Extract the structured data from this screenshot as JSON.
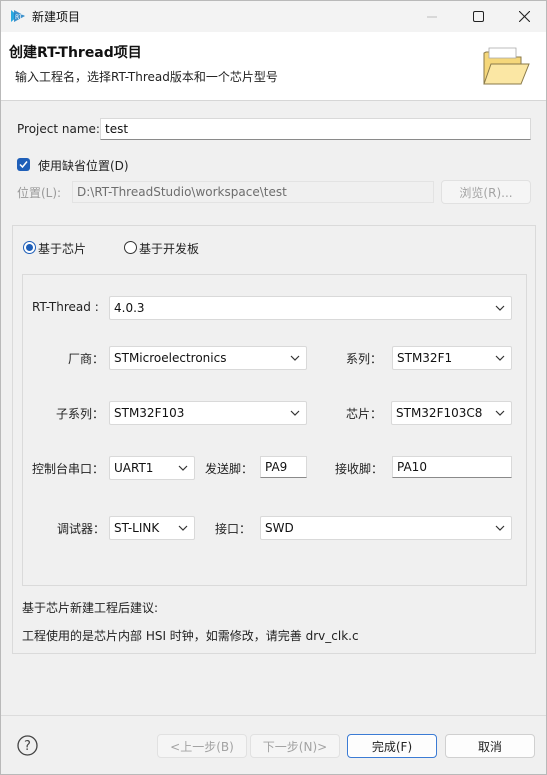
{
  "window": {
    "title": "新建项目"
  },
  "header": {
    "title": "创建RT-Thread项目",
    "description": "输入工程名，选择RT-Thread版本和一个芯片型号"
  },
  "project": {
    "name_label": "Project name:",
    "name_value": "test",
    "use_default_location_label": "使用缺省位置(D)",
    "use_default_location_checked": true,
    "location_label": "位置(L):",
    "location_value": "D:\\RT-ThreadStudio\\workspace\\test",
    "browse_label": "浏览(R)..."
  },
  "mode": {
    "chip_label": "基于芯片",
    "board_label": "基于开发板",
    "selected": "chip"
  },
  "config": {
    "rtthread_label": "RT-Thread :",
    "rtthread_value": "4.0.3",
    "vendor_label": "厂商：",
    "vendor_value": "STMicroelectronics",
    "series_label": "系列：",
    "series_value": "STM32F1",
    "subseries_label": "子系列：",
    "subseries_value": "STM32F103",
    "chip_label": "芯片：",
    "chip_value": "STM32F103C8",
    "console_label": "控制台串口：",
    "console_value": "UART1",
    "tx_label": "发送脚：",
    "tx_value": "PA9",
    "rx_label": "接收脚：",
    "rx_value": "PA10",
    "debugger_label": "调试器：",
    "debugger_value": "ST-LINK",
    "interface_label": "接口：",
    "interface_value": "SWD"
  },
  "advice": {
    "title": "基于芯片新建工程后建议:",
    "text": "工程使用的是芯片内部 HSI 时钟，如需修改，请完善 drv_clk.c"
  },
  "footer": {
    "back_label": "<上一步(B)",
    "next_label": "下一步(N)>",
    "finish_label": "完成(F)",
    "cancel_label": "取消"
  },
  "colors": {
    "accent": "#1f5fb8",
    "window_bg": "#f0f0f0",
    "header_bg": "#ffffff",
    "primary_border": "#3b7bd4"
  }
}
